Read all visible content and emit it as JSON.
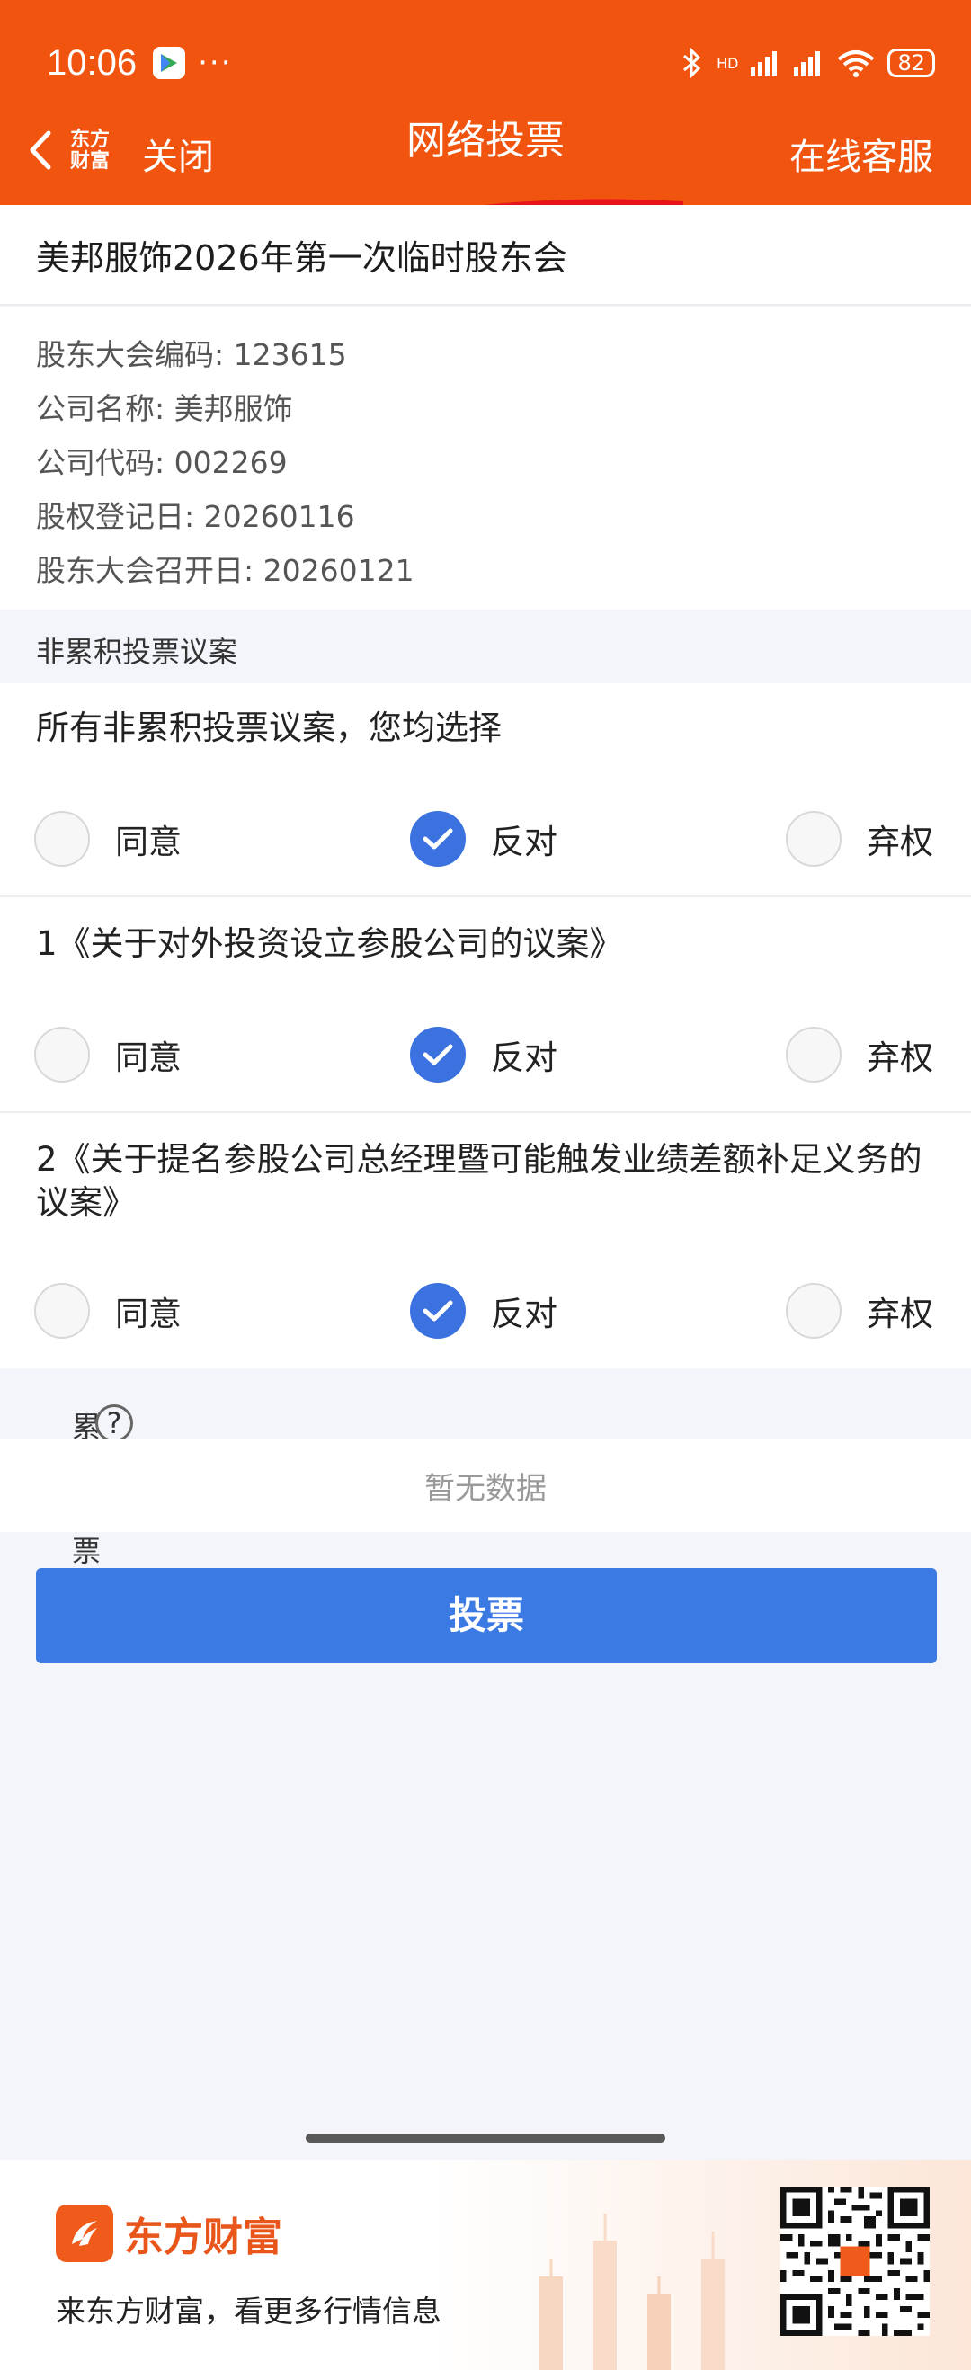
{
  "status_bar": {
    "time": "10:06",
    "battery": "82",
    "signal_label": "HD"
  },
  "nav": {
    "back_brand_line1": "东方",
    "back_brand_line2": "财富",
    "close_label": "关闭",
    "title": "网络投票",
    "service_label": "在线客服"
  },
  "meeting": {
    "title": "美邦服饰2026年第一次临时股东会",
    "info": [
      "股东大会编码: 123615",
      "公司名称: 美邦服饰",
      "公司代码: 002269",
      "股权登记日: 20260116",
      "股东大会召开日: 20260121"
    ]
  },
  "non_cumulative": {
    "header": "非累积投票议案",
    "select_all_text": "所有非累积投票议案，您均选择",
    "options": [
      "同意",
      "反对",
      "弃权"
    ],
    "select_all_choice": "反对",
    "proposals": [
      {
        "text": "1《关于对外投资设立参股公司的议案》",
        "choice": "反对"
      },
      {
        "text": "2《关于提名参股公司总经理暨可能触发业绩差额补足义务的议案》",
        "choice": "反对"
      }
    ]
  },
  "cumulative": {
    "header": "累积投票议案",
    "help_symbol": "?",
    "empty_text": "暂无数据"
  },
  "vote_button_label": "投票",
  "footer": {
    "brand": "东方财富",
    "slogan": "来东方财富，看更多行情信息"
  },
  "colors": {
    "brand_orange": "#f0540f",
    "primary_blue": "#3b7ae3",
    "page_bg": "#f3f5fb"
  }
}
